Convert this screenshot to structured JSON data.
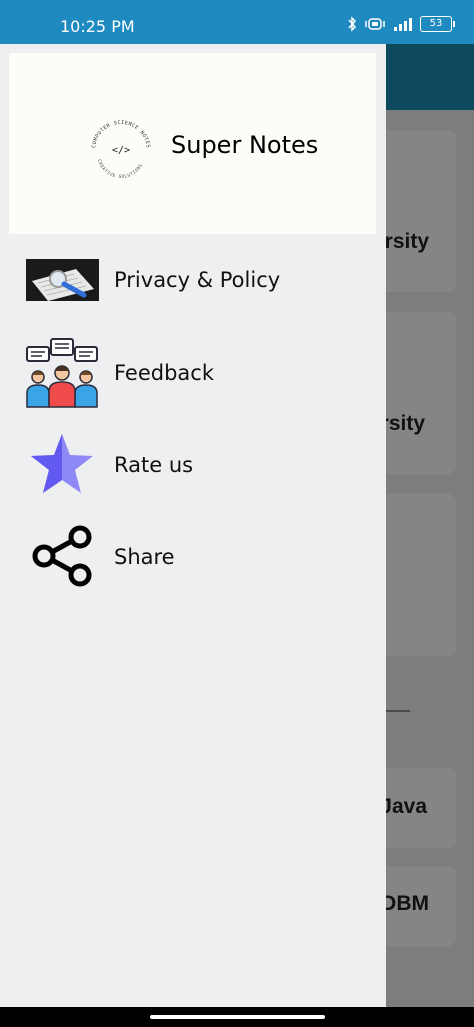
{
  "status_bar": {
    "time": "10:25 PM",
    "battery": "53"
  },
  "background_app": {
    "card_texts": [
      "rsity",
      "rsity",
      "Java",
      "DBM"
    ]
  },
  "drawer": {
    "app_name": "Super Notes",
    "logo_text": "COMPUTER SCIENCE NOTES CREATIVE SOLUTIONS",
    "items": [
      {
        "label": "Privacy & Policy",
        "icon": "magnifier-document-icon"
      },
      {
        "label": "Feedback",
        "icon": "feedback-people-icon"
      },
      {
        "label": "Rate us",
        "icon": "star-icon"
      },
      {
        "label": "Share",
        "icon": "share-icon"
      }
    ]
  },
  "colors": {
    "status_bar": "#1f8ac0",
    "drawer_bg": "#eeeff0",
    "toolbar": "#0d4a5d",
    "star": "#6c63f5"
  }
}
